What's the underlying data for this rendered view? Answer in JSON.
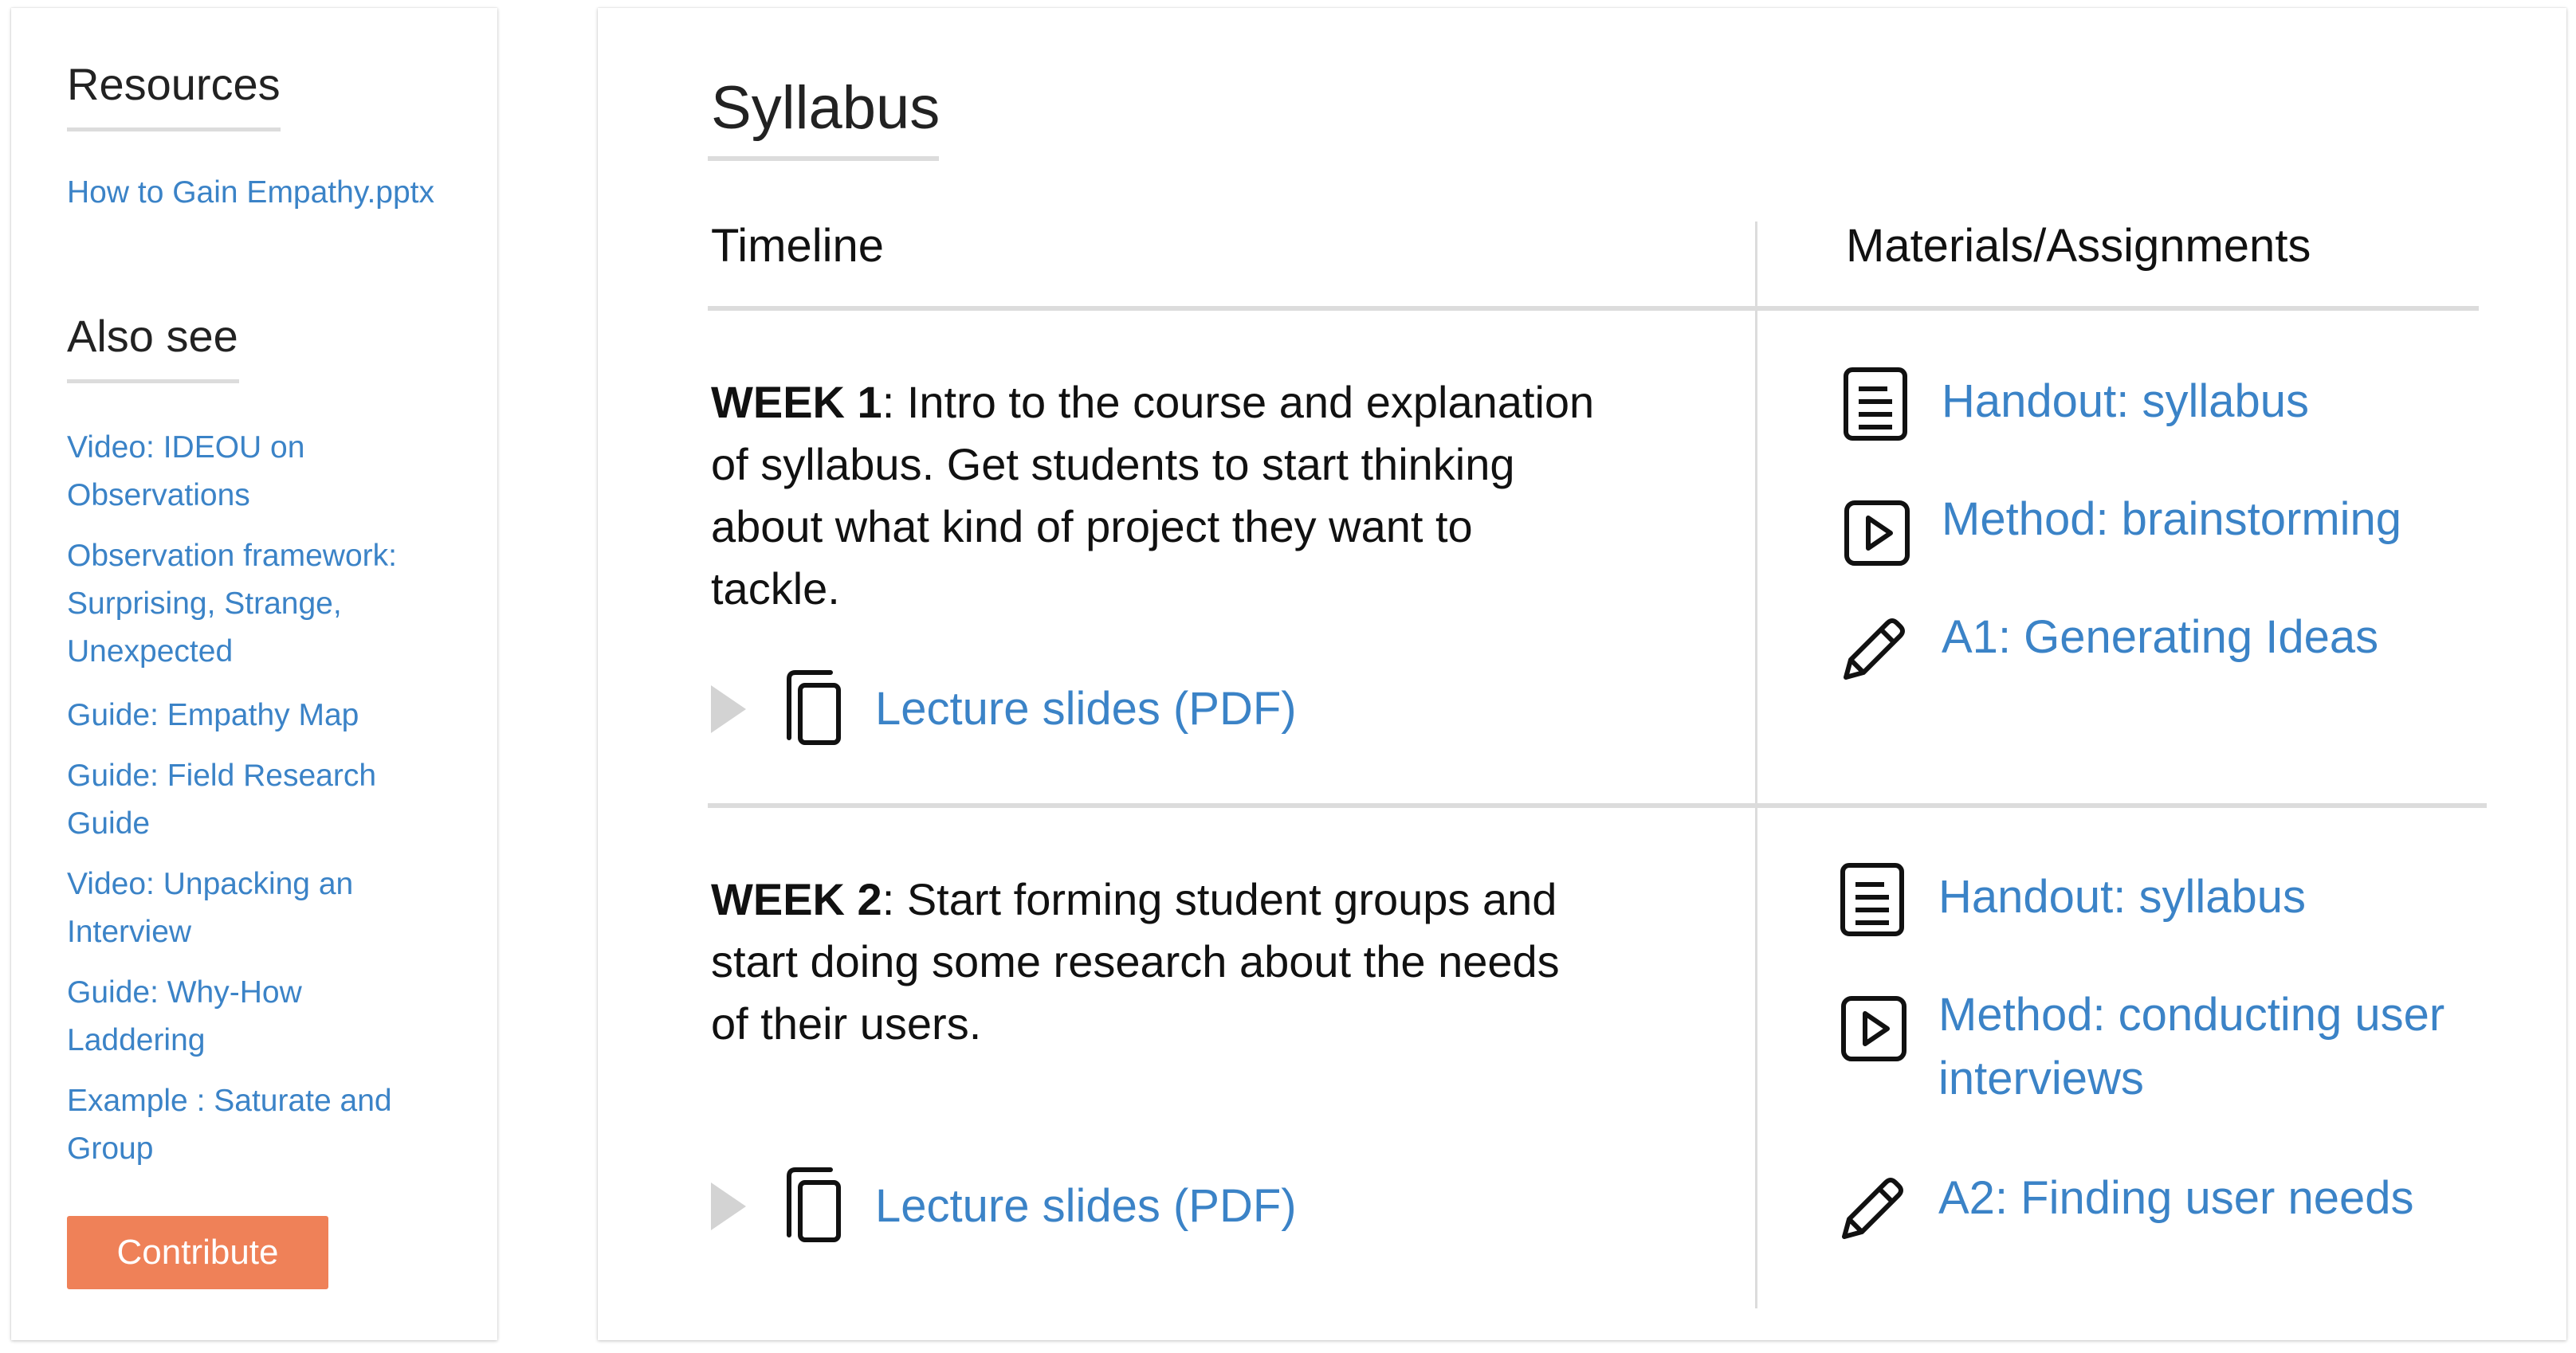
{
  "sidebar": {
    "resources_heading": "Resources",
    "resources": [
      {
        "label": "How to Gain Empathy.pptx"
      }
    ],
    "also_see_heading": "Also see",
    "also_see": [
      {
        "lines": [
          "Video: IDEOU on",
          "Observations"
        ]
      },
      {
        "lines": [
          "Observation framework:",
          "Surprising, Strange,",
          "Unexpected"
        ]
      },
      {
        "lines": [
          "Guide: Empathy Map"
        ]
      },
      {
        "lines": [
          "Guide: Field Research",
          "Guide"
        ]
      },
      {
        "lines": [
          "Video: Unpacking an",
          "Interview"
        ]
      },
      {
        "lines": [
          "Guide: Why-How",
          "Laddering"
        ]
      },
      {
        "lines": [
          "Example : Saturate and",
          "Group"
        ]
      }
    ],
    "contribute_label": "Contribute"
  },
  "main": {
    "title": "Syllabus",
    "columns": {
      "timeline": "Timeline",
      "materials": "Materials/Assignments"
    },
    "weeks": [
      {
        "label": "WEEK 1",
        "description_lines": [
          ": Intro to the course and explanation",
          "of syllabus. Get students to start thinking",
          "about what kind of project they want to",
          "tackle."
        ],
        "slides_label": "Lecture slides (PDF)",
        "materials": [
          {
            "icon": "document-icon",
            "lines": [
              "Handout: syllabus"
            ]
          },
          {
            "icon": "video-play-icon",
            "lines": [
              "Method: brainstorming"
            ]
          },
          {
            "icon": "pencil-icon",
            "lines": [
              "A1: Generating Ideas"
            ]
          }
        ]
      },
      {
        "label": "WEEK 2",
        "description_lines": [
          ": Start forming student groups and",
          "start doing some research about the needs",
          "of their users."
        ],
        "slides_label": "Lecture slides (PDF)",
        "materials": [
          {
            "icon": "document-icon",
            "lines": [
              "Handout: syllabus"
            ]
          },
          {
            "icon": "video-play-icon",
            "lines": [
              "Method: conducting user",
              "interviews"
            ]
          },
          {
            "icon": "pencil-icon",
            "lines": [
              "A2: Finding user needs"
            ]
          }
        ]
      }
    ]
  },
  "colors": {
    "link": "#3b83c7",
    "accent": "#ef8158",
    "rule": "#dcdcdc",
    "play_arrow": "#d3d3d3"
  }
}
